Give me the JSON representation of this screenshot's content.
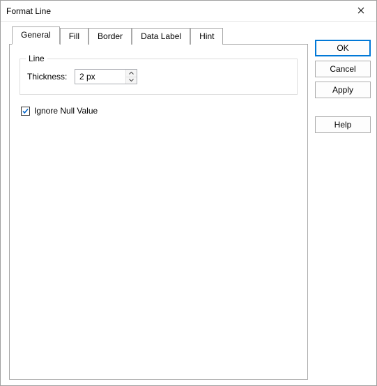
{
  "title": "Format Line",
  "tabs": {
    "general": "General",
    "fill": "Fill",
    "border": "Border",
    "dataLabel": "Data Label",
    "hint": "Hint"
  },
  "group": {
    "line": "Line",
    "thicknessLabel": "Thickness:",
    "thicknessValue": "2 px"
  },
  "ignoreNull": {
    "label": "Ignore Null Value",
    "checked": true
  },
  "buttons": {
    "ok": "OK",
    "cancel": "Cancel",
    "apply": "Apply",
    "help": "Help"
  }
}
